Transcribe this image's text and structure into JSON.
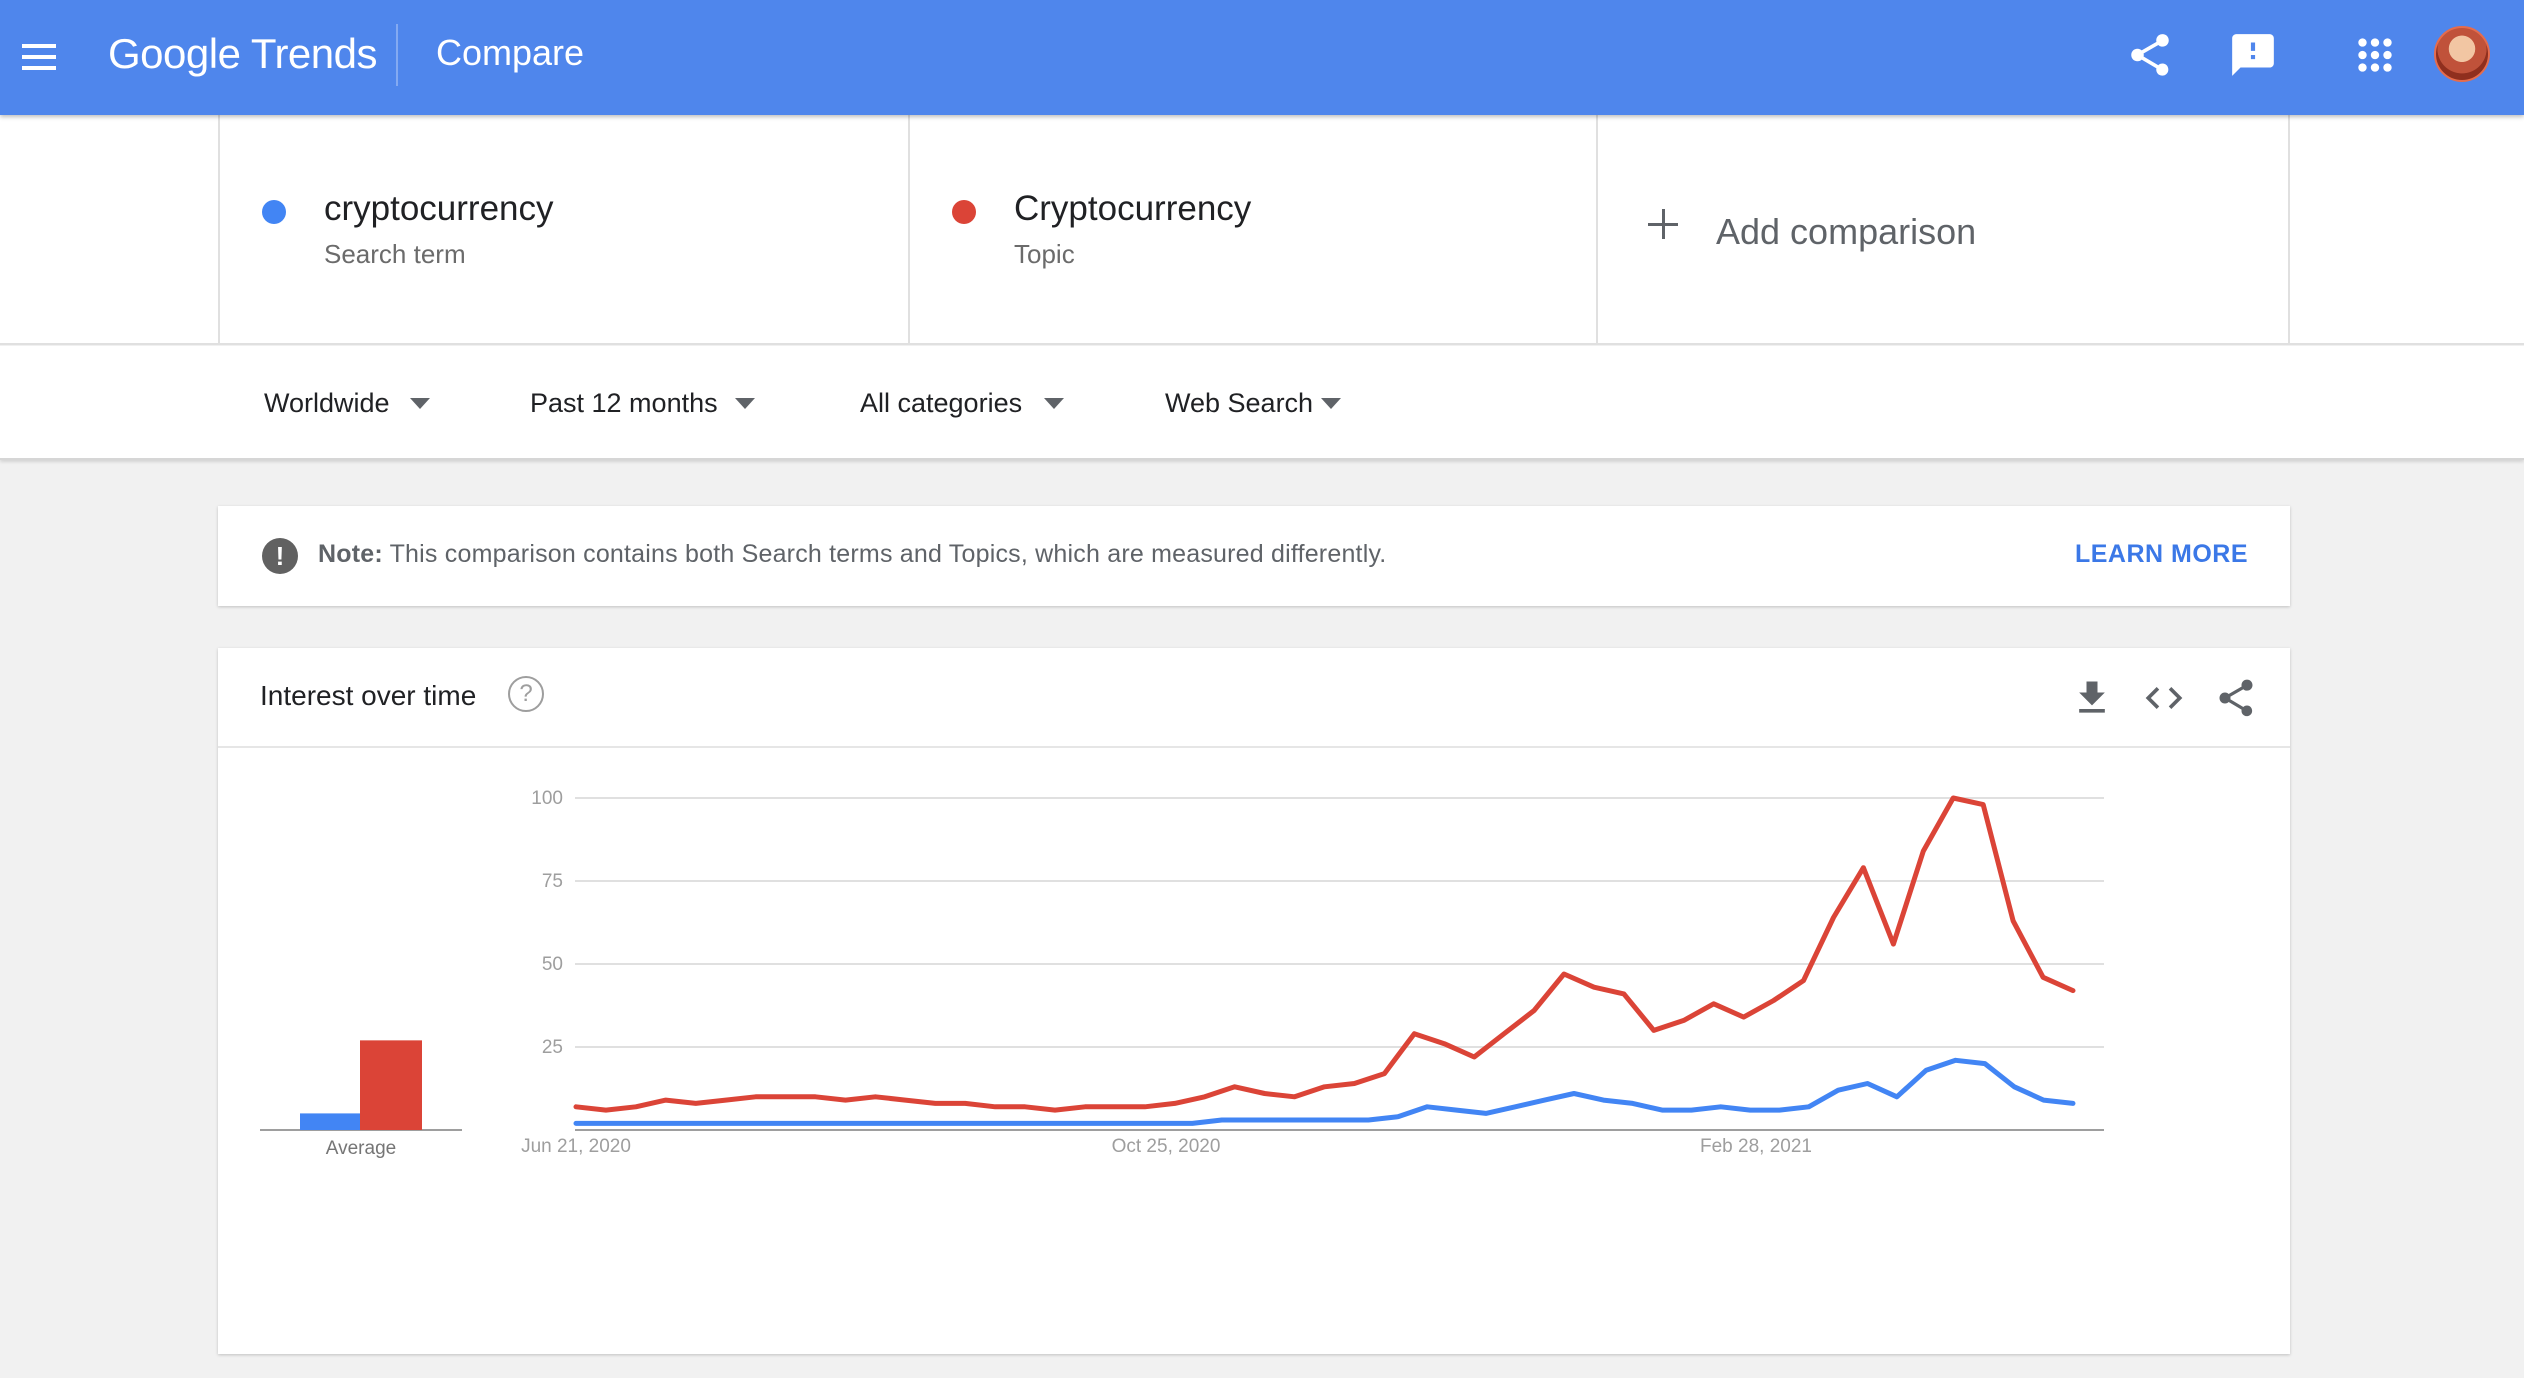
{
  "header": {
    "logo_text": "Google Trends",
    "page_title": "Compare",
    "bg_color": "#4f86ec"
  },
  "terms": [
    {
      "name": "cryptocurrency",
      "type": "Search term",
      "color": "#4285f4"
    },
    {
      "name": "Cryptocurrency",
      "type": "Topic",
      "color": "#db4437"
    }
  ],
  "add_comparison": {
    "label": "Add comparison"
  },
  "filters": {
    "region": "Worldwide",
    "time_range": "Past 12 months",
    "category": "All categories",
    "property": "Web Search"
  },
  "note": {
    "label": "Note:",
    "text": " This comparison contains both Search terms and Topics, which are measured differently.",
    "action": "LEARN MORE"
  },
  "interest_card": {
    "title": "Interest over time",
    "help_glyph": "?",
    "icons": [
      "download-icon",
      "embed-icon",
      "share-icon"
    ]
  },
  "chart_data": {
    "type": "line",
    "title": "",
    "x_tick_labels": [
      "Jun 21, 2020",
      "Oct 25, 2020",
      "Feb 28, 2021"
    ],
    "y_ticks": [
      25,
      50,
      75,
      100
    ],
    "ylim": [
      0,
      100
    ],
    "grid": true,
    "average_label": "Average",
    "averages": [
      5,
      27
    ],
    "series": [
      {
        "color": "#4285f4",
        "values": [
          2,
          2,
          2,
          2,
          2,
          2,
          2,
          2,
          2,
          2,
          2,
          2,
          2,
          2,
          2,
          2,
          2,
          2,
          2,
          2,
          2,
          2,
          3,
          3,
          3,
          3,
          3,
          3,
          4,
          7,
          6,
          5,
          7,
          9,
          11,
          9,
          8,
          6,
          6,
          7,
          6,
          6,
          7,
          12,
          14,
          10,
          18,
          21,
          20,
          13,
          9,
          8
        ]
      },
      {
        "color": "#db4437",
        "values": [
          7,
          6,
          7,
          9,
          8,
          9,
          10,
          10,
          10,
          9,
          10,
          9,
          8,
          8,
          7,
          7,
          6,
          7,
          7,
          7,
          8,
          10,
          13,
          11,
          10,
          13,
          14,
          17,
          29,
          26,
          22,
          29,
          36,
          47,
          43,
          41,
          30,
          33,
          38,
          34,
          39,
          45,
          64,
          79,
          56,
          84,
          100,
          98,
          63,
          46,
          42
        ]
      }
    ]
  }
}
